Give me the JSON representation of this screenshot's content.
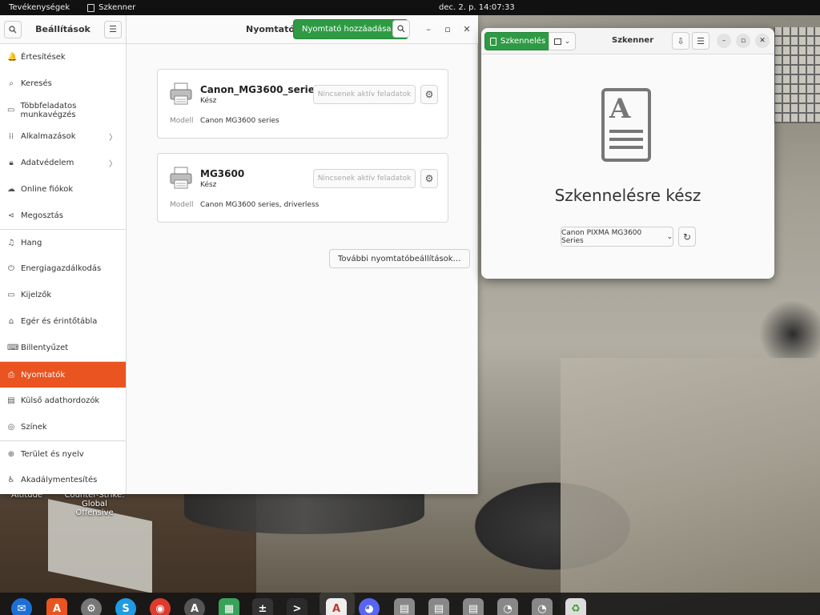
{
  "topbar": {
    "activities": "Tevékenységek",
    "app_name": "Szkenner",
    "clock": "dec. 2. p.  14:07:33"
  },
  "desktop": {
    "label_left": "Altitude",
    "label_game_line1": "Counter-Strike:",
    "label_game_line2": "Global Offensive"
  },
  "settings": {
    "sidebar_title": "Beállítások",
    "items": [
      {
        "label": "Értesítések",
        "icon": "bell-icon",
        "glyph": "🔔"
      },
      {
        "label": "Keresés",
        "icon": "search-icon",
        "glyph": "⌕"
      },
      {
        "label": "Többfeladatos munkavégzés",
        "icon": "multitasking-icon",
        "glyph": "▭"
      },
      {
        "label": "Alkalmazások",
        "icon": "apps-grid-icon",
        "glyph": "⁞⁞",
        "chevron": "〉"
      },
      {
        "label": "Adatvédelem",
        "icon": "privacy-icon",
        "glyph": "🔒︎",
        "chevron": "〉"
      },
      {
        "label": "Online fiókok",
        "icon": "cloud-icon",
        "glyph": "☁"
      },
      {
        "label": "Megosztás",
        "icon": "share-icon",
        "glyph": "⋖"
      },
      {
        "label": "Hang",
        "icon": "music-note-icon",
        "glyph": "♫"
      },
      {
        "label": "Energiagazdálkodás",
        "icon": "power-icon",
        "glyph": "⏻"
      },
      {
        "label": "Kijelzők",
        "icon": "display-icon",
        "glyph": "▭"
      },
      {
        "label": "Egér és érintőtábla",
        "icon": "mouse-icon",
        "glyph": "⌂"
      },
      {
        "label": "Billentyűzet",
        "icon": "keyboard-icon",
        "glyph": "⌨"
      },
      {
        "label": "Nyomtatók",
        "icon": "printer-icon",
        "glyph": "⎙"
      },
      {
        "label": "Külső adathordozók",
        "icon": "media-icon",
        "glyph": "▤"
      },
      {
        "label": "Színek",
        "icon": "color-icon",
        "glyph": "◎"
      },
      {
        "label": "Terület és nyelv",
        "icon": "globe-icon",
        "glyph": "⊕"
      },
      {
        "label": "Akadálymentesítés",
        "icon": "accessibility-icon",
        "glyph": "♿︎"
      }
    ],
    "header_title": "Nyomtatók",
    "add_printer_label": "Nyomtató hozzáadása…",
    "model_label": "Modell",
    "jobs_label": "Nincsenek aktív feladatok",
    "printers": [
      {
        "name": "Canon_MG3600_series",
        "status": "Kész",
        "model": "Canon MG3600 series"
      },
      {
        "name": "MG3600",
        "status": "Kész",
        "model": "Canon MG3600 series, driverless"
      }
    ],
    "more_settings_label": "További nyomtatóbeállítások…"
  },
  "scanner": {
    "title": "Szkenner",
    "scan_button": "Szkennelés",
    "ready_text": "Szkennelésre kész",
    "device": "Canon PIXMA MG3600 Series",
    "doc_letter": "A"
  },
  "colors": {
    "accent": "#e95420",
    "green": "#2e9b44"
  }
}
